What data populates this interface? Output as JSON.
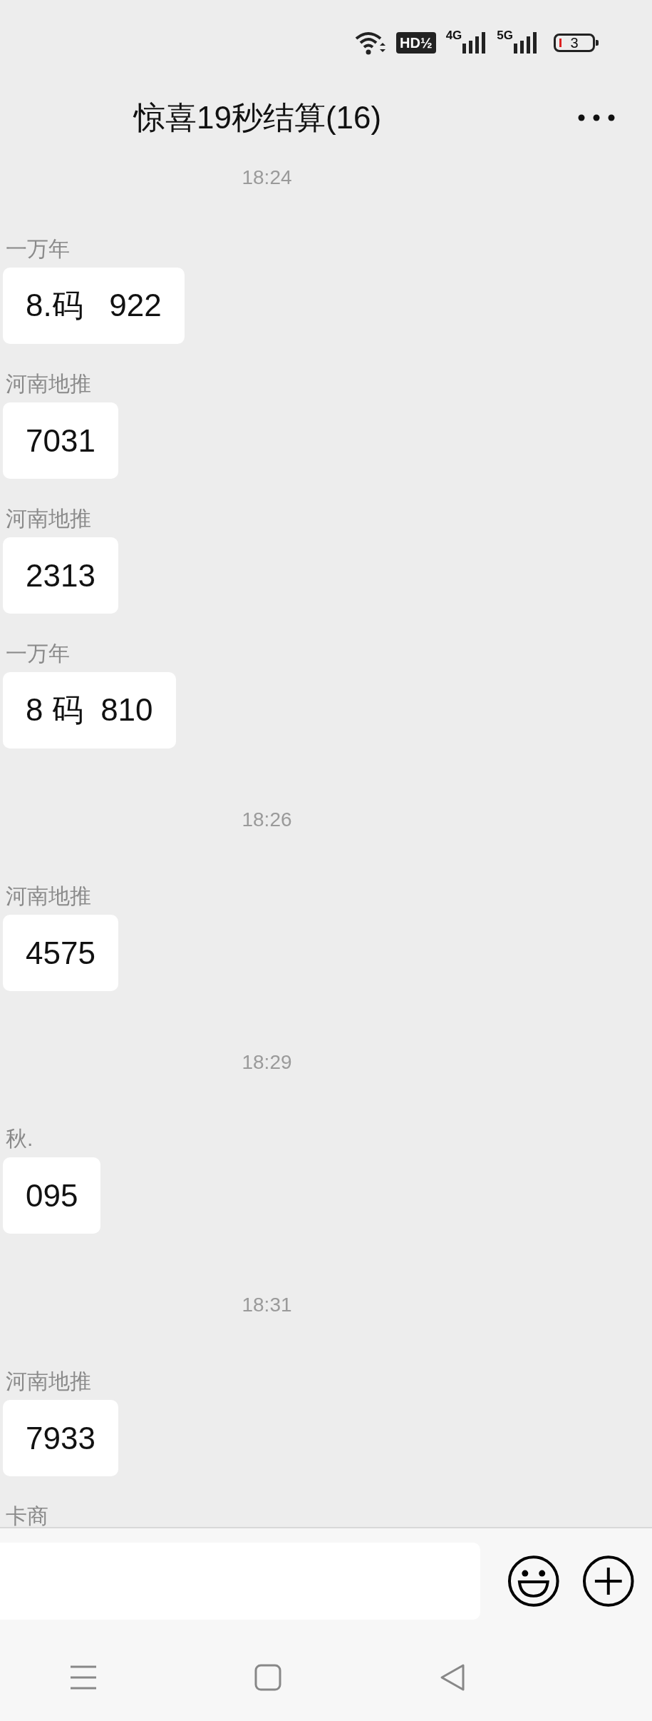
{
  "status_bar": {
    "hd_badge": "HD½",
    "signals": [
      {
        "label": "4G"
      },
      {
        "label": "5G"
      }
    ],
    "battery": "3"
  },
  "header": {
    "title": "惊喜19秒结算(16)"
  },
  "messages": [
    {
      "kind": "time",
      "text": "18:24"
    },
    {
      "kind": "message",
      "sender": "一万年",
      "text": "8.码   922"
    },
    {
      "kind": "message",
      "sender": "河南地推",
      "text": "7031"
    },
    {
      "kind": "message",
      "sender": "河南地推",
      "text": "2313"
    },
    {
      "kind": "message",
      "sender": "一万年",
      "text": "8 码  810"
    },
    {
      "kind": "time",
      "text": "18:26"
    },
    {
      "kind": "message",
      "sender": "河南地推",
      "text": "4575"
    },
    {
      "kind": "time",
      "text": "18:29"
    },
    {
      "kind": "message",
      "sender": "秋.",
      "text": "095"
    },
    {
      "kind": "time",
      "text": "18:31"
    },
    {
      "kind": "message",
      "sender": "河南地推",
      "text": "7933"
    },
    {
      "kind": "message",
      "sender": "卡商"
    }
  ]
}
